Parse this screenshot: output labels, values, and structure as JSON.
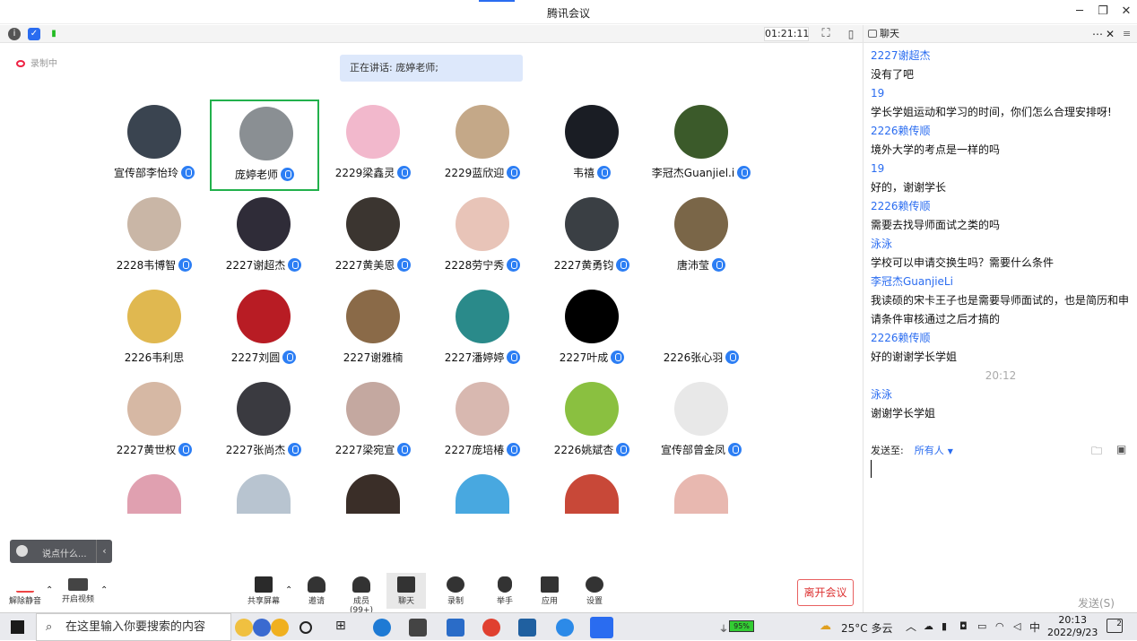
{
  "window": {
    "title": "腾讯会议"
  },
  "toolbar": {
    "timer": "01:21:11"
  },
  "main": {
    "recording": "录制中",
    "speaking": "正在讲话: 庞婷老师;"
  },
  "participants": [
    {
      "name": "宣传部李怡玲",
      "color": "#3a4450",
      "mic": true
    },
    {
      "name": "庞婷老师",
      "color": "#8a8f93",
      "mic": true,
      "host": true
    },
    {
      "name": "2229梁鑫灵",
      "color": "#f2b8cc",
      "mic": true
    },
    {
      "name": "2229蓝欣迎",
      "color": "#c4a888",
      "mic": true
    },
    {
      "name": "韦禧",
      "color": "#1a1d24",
      "mic": true
    },
    {
      "name": "李冠杰Guanjiel.i",
      "color": "#3b5a2a",
      "mic": true
    },
    {
      "name": "2228韦博智",
      "color": "#c9b6a6",
      "mic": true
    },
    {
      "name": "2227谢超杰",
      "color": "#2f2c38",
      "mic": true
    },
    {
      "name": "2227黄美恩",
      "color": "#3b3530",
      "mic": true
    },
    {
      "name": "2228劳宁秀",
      "color": "#e8c4b8",
      "mic": true
    },
    {
      "name": "2227黄勇钧",
      "color": "#3a3f44",
      "mic": true
    },
    {
      "name": "唐沛莹",
      "color": "#7a6648",
      "mic": true
    },
    {
      "name": "2226韦利思",
      "color": "#e0b850",
      "mic": false
    },
    {
      "name": "2227刘圆",
      "color": "#b81c24",
      "mic": true
    },
    {
      "name": "2227谢雅楠",
      "color": "#8a6a48",
      "mic": false
    },
    {
      "name": "2227潘婷婷",
      "color": "#2a8a8a",
      "mic": true
    },
    {
      "name": "2227叶成",
      "color": "#000000",
      "mic": true
    },
    {
      "name": "2226张心羽",
      "color": "#ffffff",
      "mic": true
    },
    {
      "name": "2227黄世权",
      "color": "#d6b8a4",
      "mic": true
    },
    {
      "name": "2227张尚杰",
      "color": "#3a3a40",
      "mic": true
    },
    {
      "name": "2227梁宛宣",
      "color": "#c4a8a0",
      "mic": true
    },
    {
      "name": "2227庞培椿",
      "color": "#d8b8b0",
      "mic": true
    },
    {
      "name": "2226姚斌杏",
      "color": "#8ac040",
      "mic": true
    },
    {
      "name": "宣传部曾金凤",
      "color": "#e8e8e8",
      "mic": true
    },
    {
      "name": "",
      "color": "#e0a0b0"
    },
    {
      "name": "",
      "color": "#b8c4d0"
    },
    {
      "name": "",
      "color": "#3a2e28"
    },
    {
      "name": "",
      "color": "#48a8e0"
    },
    {
      "name": "",
      "color": "#c84838"
    },
    {
      "name": "",
      "color": "#e8b8b0"
    }
  ],
  "chatinput": {
    "placeholder": "说点什么..."
  },
  "bottombar": {
    "unmute": "解除静音",
    "video": "开启视频",
    "share": "共享屏幕",
    "invite": "邀请",
    "members": "成员(99+)",
    "chat": "聊天",
    "record": "录制",
    "raise": "举手",
    "apps": "应用",
    "settings": "设置",
    "leave": "离开会议"
  },
  "chat": {
    "title": "聊天",
    "messages": [
      {
        "sender": "2227谢超杰",
        "text": "没有了吧"
      },
      {
        "sender": "19",
        "text": "学长学姐运动和学习的时间，你们怎么合理安排呀!"
      },
      {
        "sender": "2226赖传顺",
        "text": "境外大学的考点是一样的吗"
      },
      {
        "sender": "19",
        "text": "好的，谢谢学长"
      },
      {
        "sender": "2226赖传顺",
        "text": "需要去找导师面试之类的吗"
      },
      {
        "sender": "泳泳",
        "text": "学校可以申请交换生吗？需要什么条件"
      },
      {
        "sender": "李冠杰GuanjieLi",
        "text": "我读硕的宋卡王子也是需要导师面试的，也是简历和申请条件审核通过之后才搞的"
      },
      {
        "sender": "2226赖传顺",
        "text": "好的谢谢学长学姐"
      },
      {
        "time": "20:12"
      },
      {
        "sender": "泳泳",
        "text": "谢谢学长学姐"
      }
    ],
    "send_to_label": "发送至:",
    "send_to_value": "所有人",
    "send_button": "发送(S)"
  },
  "taskbar": {
    "search_placeholder": "在这里输入你要搜索的内容",
    "battery": "95%",
    "weather": "25°C 多云",
    "ime": "中",
    "time": "20:13",
    "date": "2022/9/23",
    "notifications": "2"
  }
}
